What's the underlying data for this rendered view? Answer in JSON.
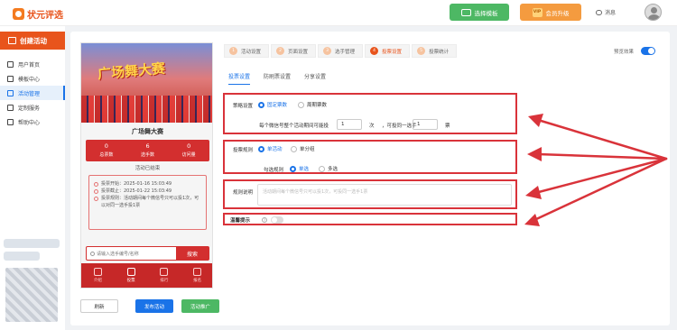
{
  "header": {
    "logo_text": "状元评选",
    "template_button": "选择模板",
    "vip_badge": "VIP",
    "vip_button": "会员升级",
    "messages": "消息"
  },
  "sidebar": {
    "create_button": "创建活动",
    "items": [
      {
        "label": "用户首页"
      },
      {
        "label": "模板中心"
      },
      {
        "label": "活动管理"
      },
      {
        "label": "定制服务"
      },
      {
        "label": "帮助中心"
      }
    ]
  },
  "preview": {
    "banner_title": "广场舞大赛",
    "card_title": "广场舞大赛",
    "stats": [
      {
        "value": "0",
        "label": "总票数"
      },
      {
        "value": "6",
        "label": "选手数"
      },
      {
        "value": "0",
        "label": "访问量"
      }
    ],
    "status": "活动已结束",
    "info": [
      "投票开始：2025-01-16 15:03:49",
      "投票截止：2025-01-22 15:03:49",
      "投票规则：活动期间每个微信号只可以投1次，可以对同一选手投1票"
    ],
    "search_placeholder": "请输入选手编号/名称",
    "search_button": "搜索",
    "nav": [
      {
        "label": "介绍"
      },
      {
        "label": "投票"
      },
      {
        "label": "排行"
      },
      {
        "label": "报名"
      }
    ]
  },
  "bottom_buttons": {
    "refresh": "刷新",
    "publish": "发布活动",
    "promote": "活动推广"
  },
  "steps": [
    {
      "num": "1",
      "label": "活动设置"
    },
    {
      "num": "2",
      "label": "页面设置"
    },
    {
      "num": "3",
      "label": "选手管理"
    },
    {
      "num": "4",
      "label": "投票设置"
    },
    {
      "num": "5",
      "label": "投票统计"
    }
  ],
  "preview_toggle_label": "预览效果",
  "tabs": [
    {
      "label": "投票设置"
    },
    {
      "label": "防刷票设置"
    },
    {
      "label": "分享设置"
    }
  ],
  "form": {
    "strategy": {
      "label": "策略设置",
      "option_fixed": "固定票数",
      "option_cycle": "周期票数",
      "prefix": "每个微信号整个活动期间可能投",
      "count": "1",
      "unit1": "次",
      "middle": "，可投同一选手",
      "per_player": "1",
      "unit2": "票"
    },
    "rule": {
      "label": "投票规则",
      "option_single": "单活动",
      "option_group": "单分组",
      "check_label": "勾选规则",
      "option_radio": "单选",
      "option_multi": "多选"
    },
    "desc": {
      "label": "规则说明",
      "placeholder": "活动期间每个微信号只可以投1次，可投同一选手1票"
    },
    "tip": {
      "label": "温馨提示"
    }
  }
}
